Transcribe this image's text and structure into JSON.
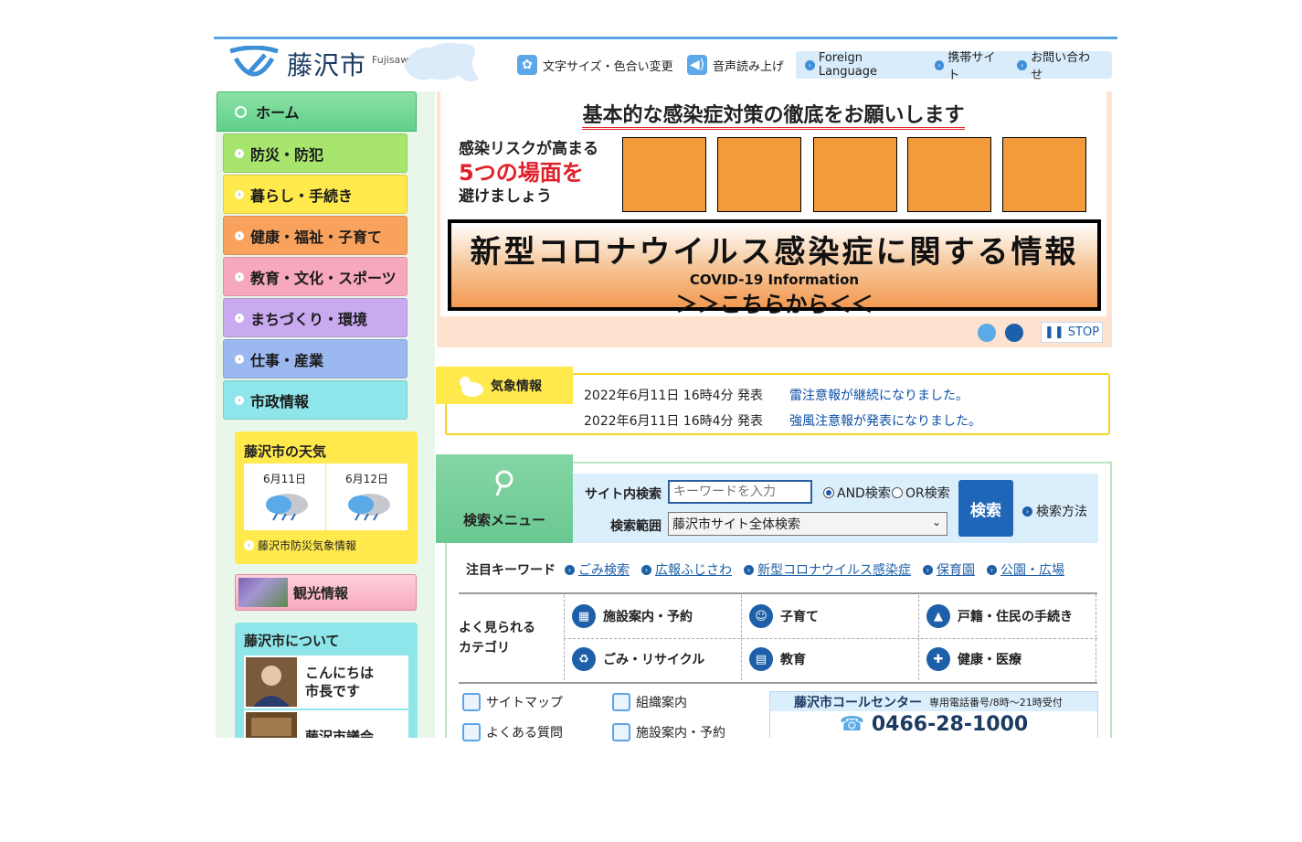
{
  "header": {
    "site_name": "藤沢市",
    "site_name_en": "Fujisawa City",
    "tools": [
      {
        "label": "文字サイズ・色合い変更",
        "icon": "gear-icon"
      },
      {
        "label": "音声読み上げ",
        "icon": "speaker-icon"
      }
    ],
    "links": [
      "Foreign Language",
      "携帯サイト",
      "お問い合わせ"
    ]
  },
  "nav": {
    "home": "ホーム",
    "items": [
      {
        "label": "防災・防犯",
        "color": "#a8e56f"
      },
      {
        "label": "暮らし・手続き",
        "color": "#ffe94d"
      },
      {
        "label": "健康・福祉・子育て",
        "color": "#f9a25e"
      },
      {
        "label": "教育・文化・スポーツ",
        "color": "#f7a8bd"
      },
      {
        "label": "まちづくり・環境",
        "color": "#c9aaf0"
      },
      {
        "label": "仕事・産業",
        "color": "#9cb8f0"
      },
      {
        "label": "市政情報",
        "color": "#8ee6ea"
      }
    ]
  },
  "weather": {
    "title": "藤沢市の天気",
    "days": [
      {
        "date": "6月11日",
        "icon": "rain-cloud-icon"
      },
      {
        "date": "6月12日",
        "icon": "rain-cloud-icon"
      }
    ],
    "link": "藤沢市防災気象情報"
  },
  "tourism": {
    "label": "観光情報"
  },
  "about": {
    "title": "藤沢市について",
    "cards": [
      {
        "line1": "こんにちは",
        "line2": "市長です"
      },
      {
        "line1": "藤沢市議会",
        "line2": ""
      }
    ]
  },
  "banner": {
    "title": "基本的な感染症対策の徹底をお願いします",
    "risk_line1": "感染リスクが高まる",
    "risk_line2": "5つの場面を",
    "risk_line3": "避けましょう",
    "covid_title": "新型コロナウイルス感染症に関する情報",
    "covid_en": "COVID-19 Information",
    "covid_link": "＞＞こちらから＜＜",
    "stop_label": "STOP"
  },
  "warnings": {
    "label": "気象情報",
    "items": [
      {
        "date": "2022年6月11日 16時4分 発表",
        "text": "雷注意報が継続になりました。"
      },
      {
        "date": "2022年6月11日 16時4分 発表",
        "text": "強風注意報が発表になりました。"
      }
    ]
  },
  "search": {
    "tab_label": "検索メニュー",
    "site_search_label": "サイト内検索",
    "placeholder": "キーワードを入力",
    "and_label": "AND検索",
    "or_label": "OR検索",
    "scope_label": "検索範囲",
    "scope_value": "藤沢市サイト全体検索",
    "button": "検索",
    "howto": "検索方法"
  },
  "keywords": {
    "label": "注目キーワード",
    "items": [
      "ごみ検索",
      "広報ふじさわ",
      "新型コロナウイルス感染症",
      "保育園",
      "公園・広場"
    ]
  },
  "categories": {
    "head_line1": "よく見られる",
    "head_line2": "カテゴリ",
    "items": [
      {
        "label": "施設案内・予約",
        "icon": "building-icon"
      },
      {
        "label": "子育て",
        "icon": "baby-icon"
      },
      {
        "label": "戸籍・住民の手続き",
        "icon": "stamp-icon"
      },
      {
        "label": "ごみ・リサイクル",
        "icon": "recycle-icon"
      },
      {
        "label": "教育",
        "icon": "book-icon"
      },
      {
        "label": "健康・医療",
        "icon": "medical-icon"
      }
    ]
  },
  "quick_links": [
    "サイトマップ",
    "組織案内",
    "よくある質問",
    "施設案内・予約"
  ],
  "call_center": {
    "title": "藤沢市コールセンター",
    "subtitle": "専用電話番号/8時〜21時受付",
    "phone": "0466-28-1000"
  }
}
